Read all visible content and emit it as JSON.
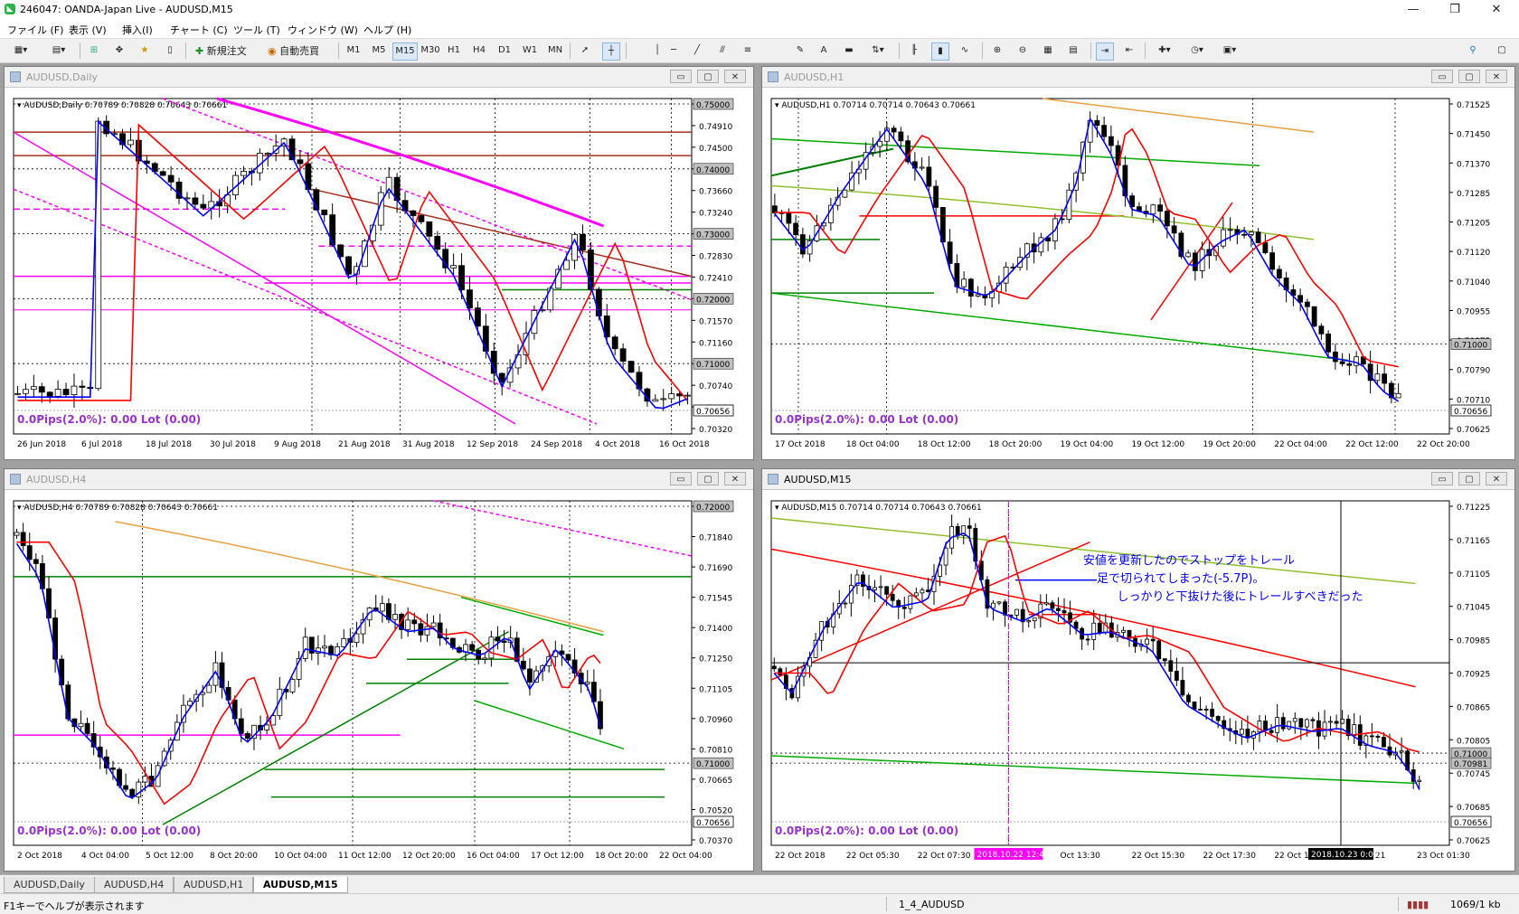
{
  "app": {
    "title": "246047: OANDA-Japan Live - AUDUSD,M15",
    "win_min": "—",
    "win_max": "❐",
    "win_close": "✕"
  },
  "menu": [
    "ファイル (F)",
    "表示 (V)",
    "挿入(I)",
    "チャート (C)",
    "ツール (T)",
    "ウィンドウ (W)",
    "ヘルプ (H)"
  ],
  "toolbar": {
    "new_order": "新規注文",
    "auto_trade": "自動売買",
    "timeframes": [
      "M1",
      "M5",
      "M15",
      "M30",
      "H1",
      "H4",
      "D1",
      "W1",
      "MN"
    ],
    "active_tf": "M15"
  },
  "info_text": "0.0Pips(2.0%): 0.00 Lot (0.00)",
  "colors": {
    "blue_ma": "#0000ff",
    "red_ma": "#ff0000",
    "pink": "#ff00ff",
    "green": "#00aa00",
    "darkgreen": "#008000",
    "lightgreen": "#90c030",
    "orange": "#e6a040",
    "brown": "#a03020",
    "purple_info": "#9933cc"
  },
  "windows": [
    {
      "id": "daily",
      "caption": "AUDUSD,Daily",
      "header": "AUDUSD,Daily  0.70789 0.70828 0.70643 0.70661",
      "price_labels": [
        "0.75000",
        "0.74910",
        "0.74500",
        "0.74000",
        "0.73660",
        "0.73240",
        "0.73000",
        "0.72830",
        "0.72410",
        "0.72000",
        "0.71570",
        "0.71160",
        "0.71000",
        "0.70740",
        "0.70656",
        "0.70320"
      ],
      "price_tags": [
        "0.75000",
        "0.74000",
        "0.73000",
        "0.72000",
        "0.71000"
      ],
      "current_price": "0.70656",
      "time_labels": [
        "26 Jun 2018",
        "6 Jul 2018",
        "18 Jul 2018",
        "30 Jul 2018",
        "9 Aug 2018",
        "21 Aug 2018",
        "31 Aug 2018",
        "12 Sep 2018",
        "24 Sep 2018",
        "4 Oct 2018",
        "16 Oct 2018"
      ]
    },
    {
      "id": "h1",
      "caption": "AUDUSD,H1",
      "header": "AUDUSD,H1  0.70714 0.70714 0.70643 0.70661",
      "price_labels": [
        "0.71525",
        "0.71450",
        "0.71370",
        "0.71285",
        "0.71205",
        "0.71120",
        "0.71040",
        "0.70955",
        "0.70875",
        "0.70790",
        "0.70710",
        "0.70625"
      ],
      "price_tags": [
        "0.71000"
      ],
      "current_price": "0.70656",
      "time_labels": [
        "17 Oct 2018",
        "18 Oct 04:00",
        "18 Oct 12:00",
        "18 Oct 20:00",
        "19 Oct 04:00",
        "19 Oct 12:00",
        "19 Oct 20:00",
        "22 Oct 04:00",
        "22 Oct 12:00",
        "22 Oct 20:00"
      ]
    },
    {
      "id": "h4",
      "caption": "AUDUSD,H4",
      "header": "AUDUSD,H4  0.70789 0.70828 0.70643 0.70661",
      "price_labels": [
        "0.72000",
        "0.71840",
        "0.71690",
        "0.71545",
        "0.71400",
        "0.71250",
        "0.71105",
        "0.70960",
        "0.70810",
        "0.70665",
        "0.70520",
        "0.70370"
      ],
      "price_tags": [
        "0.72000",
        "0.71000"
      ],
      "current_price": "0.70656",
      "time_labels": [
        "2 Oct 2018",
        "4 Oct 04:00",
        "5 Oct 12:00",
        "8 Oct 20:00",
        "10 Oct 04:00",
        "11 Oct 12:00",
        "12 Oct 20:00",
        "16 Oct 04:00",
        "17 Oct 12:00",
        "18 Oct 20:00",
        "22 Oct 04:00"
      ]
    },
    {
      "id": "m15",
      "caption": "AUDUSD,M15",
      "header": "AUDUSD,M15  0.70714 0.70714 0.70643 0.70661",
      "price_labels": [
        "0.71225",
        "0.71165",
        "0.71105",
        "0.71045",
        "0.70985",
        "0.70925",
        "0.70865",
        "0.70805",
        "0.70745",
        "0.70685",
        "0.70625"
      ],
      "price_tags": [
        "0.71000",
        "0.70981"
      ],
      "current_price": "0.70656",
      "time_labels": [
        "22 Oct 2018",
        "22 Oct 05:30",
        "22 Oct 07:30",
        "22 Oct 09:30",
        "Oct 13:30",
        "22 Oct 15:30",
        "22 Oct 17:30",
        "22 Oct 19:30",
        "22 Oct 21",
        "23 Oct 01:30"
      ],
      "marker_left": "2018.10.22 12:45",
      "marker_right": "2018.10.23 0:00",
      "annotation": [
        "安値を更新したのでストップをトレール",
        "足で切られてしまった(-5.7P)。",
        "しっかりと下抜けた後にトレールすべきだった"
      ]
    }
  ],
  "tabs": [
    "AUDUSD,Daily",
    "AUDUSD,H4",
    "AUDUSD,H1",
    "AUDUSD,M15"
  ],
  "active_tab": "AUDUSD,M15",
  "status": {
    "help": "F1キーでヘルプが表示されます",
    "profile": "1_4_AUDUSD",
    "traffic": "1069/1 kb"
  }
}
